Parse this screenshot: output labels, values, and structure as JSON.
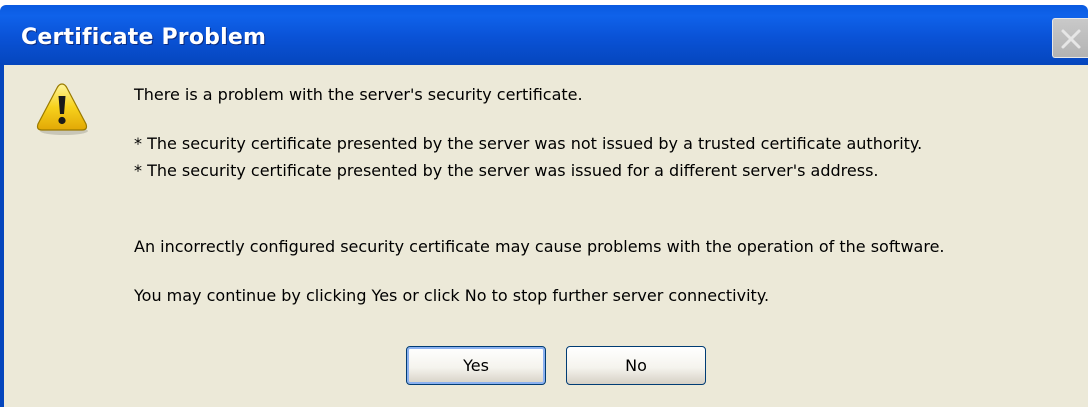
{
  "window": {
    "title": "Certificate Problem",
    "close_icon": "close-icon",
    "accent_color": "#0a52d6",
    "client_bg": "#ece9d8"
  },
  "icon": {
    "name": "warning-icon",
    "color": "#f7d21c"
  },
  "message": {
    "line1": "There is a problem with the server's security certificate.",
    "bullet1": "* The security certificate presented by the server was not issued by a trusted certificate authority.",
    "bullet2": "* The security certificate presented by the server was issued for a different server's address.",
    "line2": "An incorrectly configured security certificate may cause problems with the operation of the software.",
    "line3": "You may continue by clicking Yes or click No to stop further server connectivity."
  },
  "buttons": {
    "yes_label": "Yes",
    "no_label": "No"
  }
}
